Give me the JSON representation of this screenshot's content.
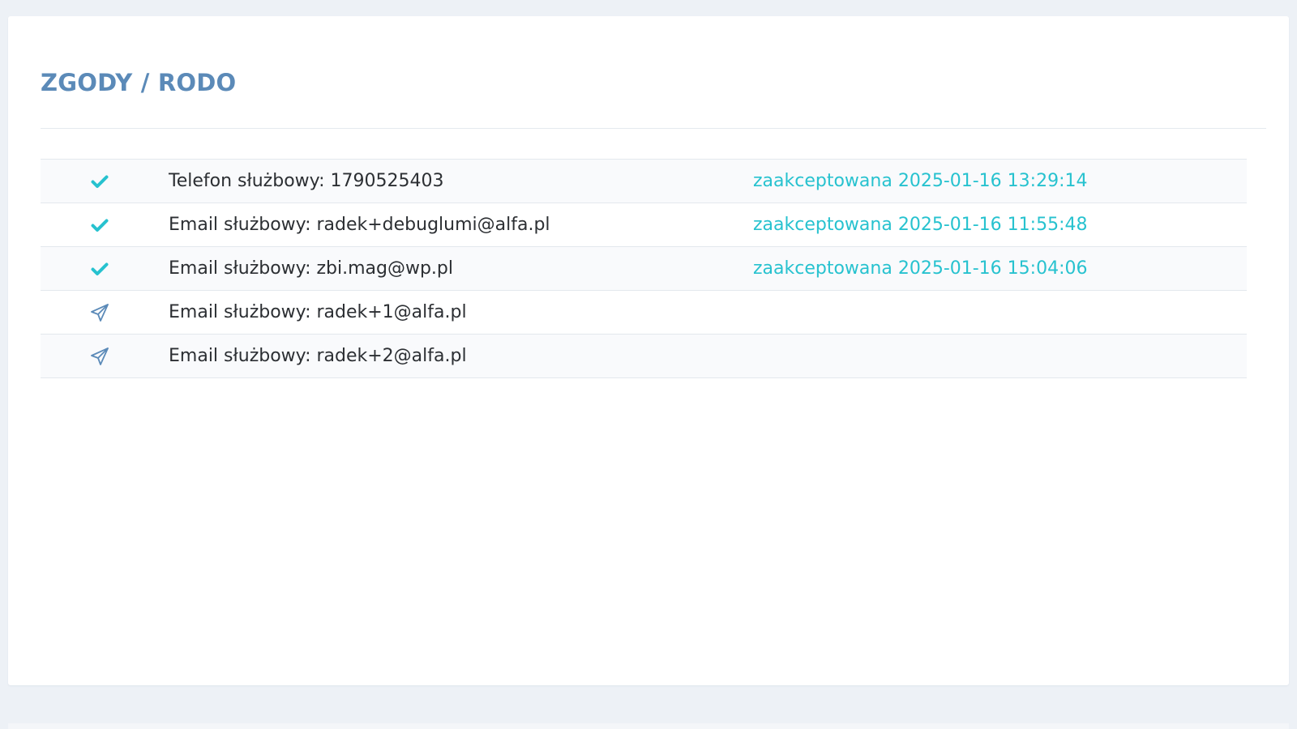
{
  "panel": {
    "title": "ZGODY / RODO"
  },
  "consents": [
    {
      "icon": "checkmark-icon",
      "label": "Telefon służbowy: 1790525403",
      "status": "zaakceptowana 2025-01-16 13:29:14"
    },
    {
      "icon": "checkmark-icon",
      "label": "Email służbowy: radek+debuglumi@alfa.pl",
      "status": "zaakceptowana 2025-01-16 11:55:48"
    },
    {
      "icon": "checkmark-icon",
      "label": "Email służbowy: zbi.mag@wp.pl",
      "status": "zaakceptowana 2025-01-16 15:04:06"
    },
    {
      "icon": "paper-plane-icon",
      "label": "Email służbowy: radek+1@alfa.pl",
      "status": ""
    },
    {
      "icon": "paper-plane-icon",
      "label": "Email służbowy: radek+2@alfa.pl",
      "status": ""
    }
  ],
  "colors": {
    "background": "#edf1f6",
    "title": "#5b8ab8",
    "accepted": "#27c2cf",
    "pending_icon": "#5b8ab8",
    "text": "#2c2f33"
  }
}
